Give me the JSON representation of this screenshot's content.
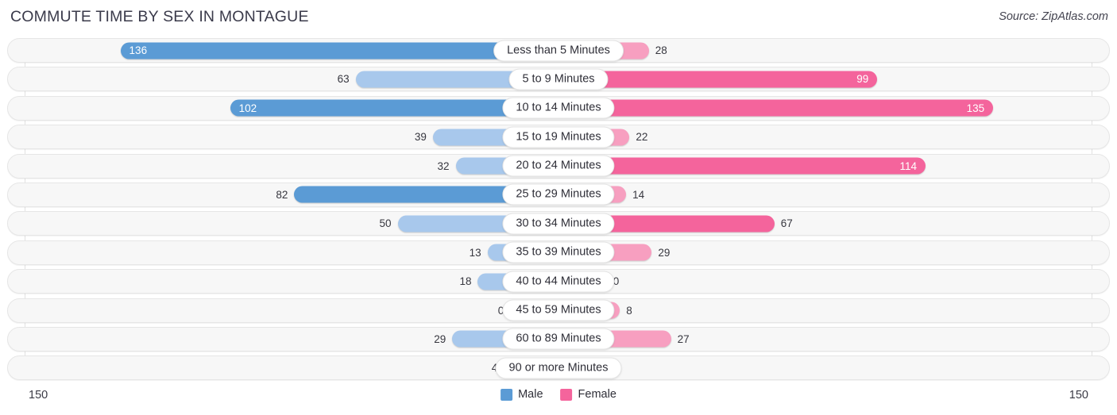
{
  "header": {
    "title": "COMMUTE TIME BY SEX IN MONTAGUE",
    "source": "Source: ZipAtlas.com"
  },
  "axis": {
    "min_label": "150",
    "max_label": "150"
  },
  "legend": {
    "items": [
      {
        "label": "Male",
        "color": "#5B9BD5"
      },
      {
        "label": "Female",
        "color": "#F4649C"
      }
    ]
  },
  "colors": {
    "male_dark": "#5B9BD5",
    "male_light": "#A8C8EC",
    "female_dark": "#F4649C",
    "female_light": "#F79FC0",
    "row_track": "#f7f7f7",
    "row_border": "#e6e6e6",
    "gridline": "#e2e2e2",
    "title_text": "#3a3a4a"
  },
  "chart_data": {
    "type": "bar",
    "orientation": "horizontal-diverging",
    "title": "COMMUTE TIME BY SEX IN MONTAGUE",
    "xlabel": "",
    "ylabel": "",
    "xlim": [
      0,
      150
    ],
    "grid": true,
    "legend_position": "bottom-center",
    "categories": [
      "Less than 5 Minutes",
      "5 to 9 Minutes",
      "10 to 14 Minutes",
      "15 to 19 Minutes",
      "20 to 24 Minutes",
      "25 to 29 Minutes",
      "30 to 34 Minutes",
      "35 to 39 Minutes",
      "40 to 44 Minutes",
      "45 to 59 Minutes",
      "60 to 89 Minutes",
      "90 or more Minutes"
    ],
    "series": [
      {
        "name": "Male",
        "color": "#5B9BD5",
        "values": [
          136,
          63,
          102,
          39,
          32,
          82,
          50,
          13,
          18,
          0,
          29,
          4
        ]
      },
      {
        "name": "Female",
        "color": "#F4649C",
        "values": [
          28,
          99,
          135,
          22,
          114,
          14,
          67,
          29,
          0,
          8,
          27,
          0
        ]
      }
    ]
  },
  "rows": [
    {
      "label": "Less than 5 Minutes",
      "male": {
        "value": 136,
        "text": "136",
        "frac": 0.907,
        "shade": "dark",
        "inside": true
      },
      "female": {
        "value": 28,
        "text": "28",
        "frac": 0.187,
        "shade": "light",
        "inside": false
      }
    },
    {
      "label": "5 to 9 Minutes",
      "male": {
        "value": 63,
        "text": "63",
        "frac": 0.42,
        "shade": "light",
        "inside": false
      },
      "female": {
        "value": 99,
        "text": "99",
        "frac": 0.66,
        "shade": "dark",
        "inside": true
      }
    },
    {
      "label": "10 to 14 Minutes",
      "male": {
        "value": 102,
        "text": "102",
        "frac": 0.68,
        "shade": "dark",
        "inside": true
      },
      "female": {
        "value": 135,
        "text": "135",
        "frac": 0.9,
        "shade": "dark",
        "inside": true
      }
    },
    {
      "label": "15 to 19 Minutes",
      "male": {
        "value": 39,
        "text": "39",
        "frac": 0.26,
        "shade": "light",
        "inside": false
      },
      "female": {
        "value": 22,
        "text": "22",
        "frac": 0.147,
        "shade": "light",
        "inside": false
      }
    },
    {
      "label": "20 to 24 Minutes",
      "male": {
        "value": 32,
        "text": "32",
        "frac": 0.213,
        "shade": "light",
        "inside": false
      },
      "female": {
        "value": 114,
        "text": "114",
        "frac": 0.76,
        "shade": "dark",
        "inside": true
      }
    },
    {
      "label": "25 to 29 Minutes",
      "male": {
        "value": 82,
        "text": "82",
        "frac": 0.547,
        "shade": "dark",
        "inside": false
      },
      "female": {
        "value": 14,
        "text": "14",
        "frac": 0.14,
        "shade": "light",
        "inside": false
      }
    },
    {
      "label": "30 to 34 Minutes",
      "male": {
        "value": 50,
        "text": "50",
        "frac": 0.333,
        "shade": "light",
        "inside": false
      },
      "female": {
        "value": 67,
        "text": "67",
        "frac": 0.447,
        "shade": "dark",
        "inside": false
      }
    },
    {
      "label": "35 to 39 Minutes",
      "male": {
        "value": 13,
        "text": "13",
        "frac": 0.147,
        "shade": "light",
        "inside": false
      },
      "female": {
        "value": 29,
        "text": "29",
        "frac": 0.193,
        "shade": "light",
        "inside": false
      }
    },
    {
      "label": "40 to 44 Minutes",
      "male": {
        "value": 18,
        "text": "18",
        "frac": 0.167,
        "shade": "light",
        "inside": false
      },
      "female": {
        "value": 0,
        "text": "0",
        "frac": 0.1,
        "shade": "light",
        "inside": false
      }
    },
    {
      "label": "45 to 59 Minutes",
      "male": {
        "value": 0,
        "text": "0",
        "frac": 0.1,
        "shade": "light",
        "inside": false
      },
      "female": {
        "value": 8,
        "text": "8",
        "frac": 0.127,
        "shade": "light",
        "inside": false
      }
    },
    {
      "label": "60 to 89 Minutes",
      "male": {
        "value": 29,
        "text": "29",
        "frac": 0.22,
        "shade": "light",
        "inside": false
      },
      "female": {
        "value": 27,
        "text": "27",
        "frac": 0.233,
        "shade": "light",
        "inside": false
      }
    },
    {
      "label": "90 or more Minutes",
      "male": {
        "value": 4,
        "text": "4",
        "frac": 0.113,
        "shade": "light",
        "inside": false
      },
      "female": {
        "value": 0,
        "text": "0",
        "frac": 0.1,
        "shade": "light",
        "inside": false
      }
    }
  ]
}
